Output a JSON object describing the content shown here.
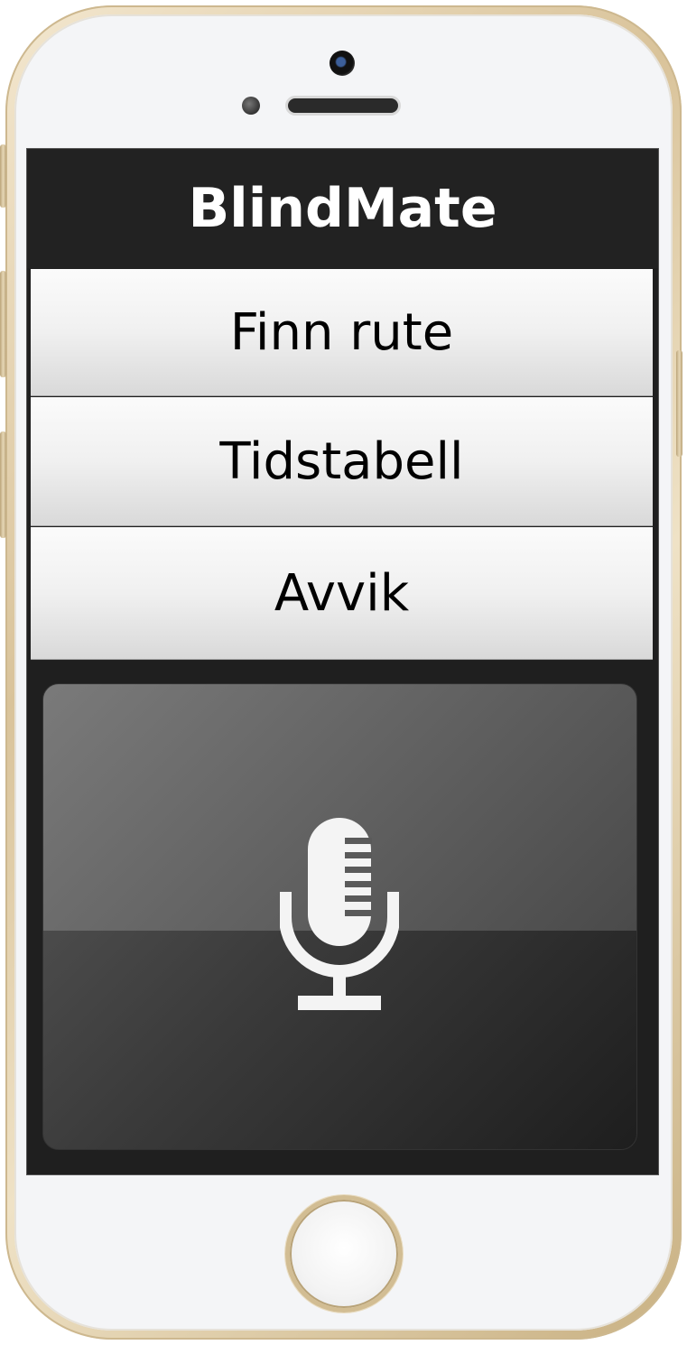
{
  "app": {
    "title": "BlindMate"
  },
  "menu": {
    "items": [
      {
        "label": "Finn rute"
      },
      {
        "label": "Tidstabell"
      },
      {
        "label": "Avvik"
      }
    ]
  },
  "voice": {
    "icon": "microphone-icon"
  },
  "device": {
    "frame_color": "#d9c39a",
    "screen_bg": "#1f1f1f"
  }
}
